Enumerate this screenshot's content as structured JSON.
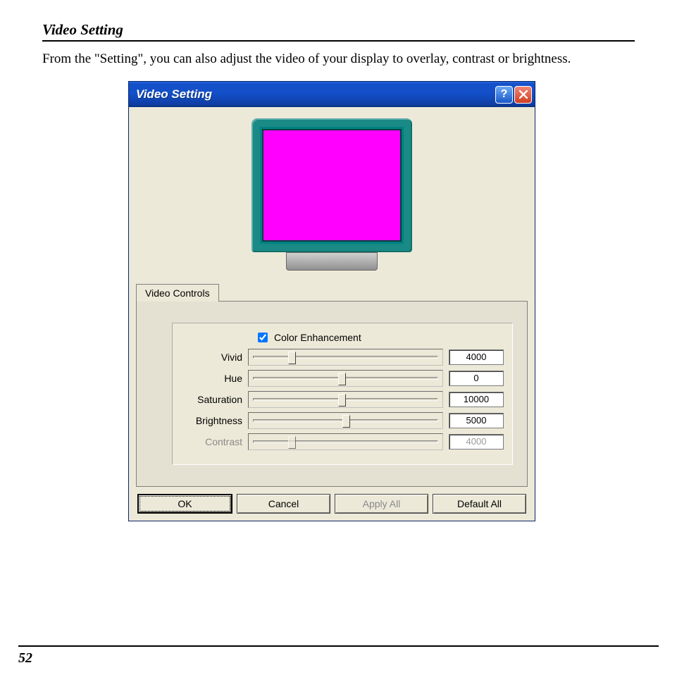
{
  "page": {
    "section_title": "Video Setting",
    "intro_text": "From the \"Setting\", you can also adjust the video of your display to overlay, contrast or brightness.",
    "page_number": "52"
  },
  "dialog": {
    "title": "Video Setting",
    "tab_label": "Video Controls",
    "checkbox_label": "Color Enhancement",
    "checkbox_checked": true,
    "sliders": [
      {
        "label": "Vivid",
        "value": "4000",
        "position_pct": 22,
        "disabled": false
      },
      {
        "label": "Hue",
        "value": "0",
        "position_pct": 48,
        "disabled": false
      },
      {
        "label": "Saturation",
        "value": "10000",
        "position_pct": 48,
        "disabled": false
      },
      {
        "label": "Brightness",
        "value": "5000",
        "position_pct": 50,
        "disabled": false
      },
      {
        "label": "Contrast",
        "value": "4000",
        "position_pct": 22,
        "disabled": true
      }
    ],
    "buttons": {
      "ok": "OK",
      "cancel": "Cancel",
      "apply_all": "Apply All",
      "default_all": "Default All"
    }
  }
}
